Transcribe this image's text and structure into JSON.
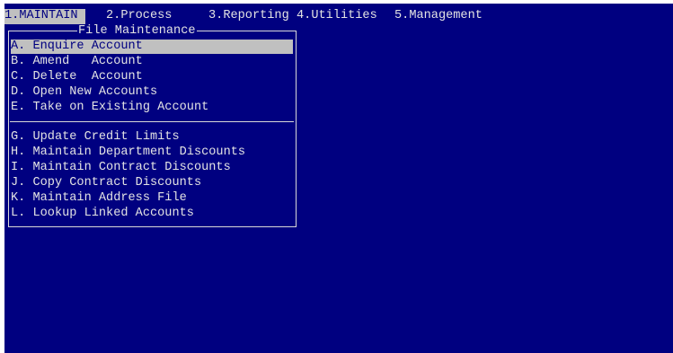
{
  "menu_bar": {
    "items": [
      {
        "label": "1.MAINTAIN ",
        "selected": true
      },
      {
        "label": "2.Process"
      },
      {
        "label": "3.Reporting"
      },
      {
        "label": "4.Utilities"
      },
      {
        "label": "5.Management"
      }
    ]
  },
  "panel": {
    "title": "File Maintenance",
    "group1": [
      {
        "label": "A. Enquire Account",
        "highlighted": true
      },
      {
        "label": "B. Amend   Account"
      },
      {
        "label": "C. Delete  Account"
      },
      {
        "label": "D. Open New Accounts"
      },
      {
        "label": "E. Take on Existing Account"
      }
    ],
    "group2": [
      {
        "label": "G. Update Credit Limits"
      },
      {
        "label": "H. Maintain Department Discounts"
      },
      {
        "label": "I. Maintain Contract Discounts"
      },
      {
        "label": "J. Copy Contract Discounts"
      },
      {
        "label": "K. Maintain Address File"
      },
      {
        "label": "L. Lookup Linked Accounts"
      }
    ]
  },
  "colors": {
    "screen_bg": "#000080",
    "text": "#e3e3e3",
    "highlight_bg": "#c0c0c0",
    "highlight_text": "#000080"
  }
}
